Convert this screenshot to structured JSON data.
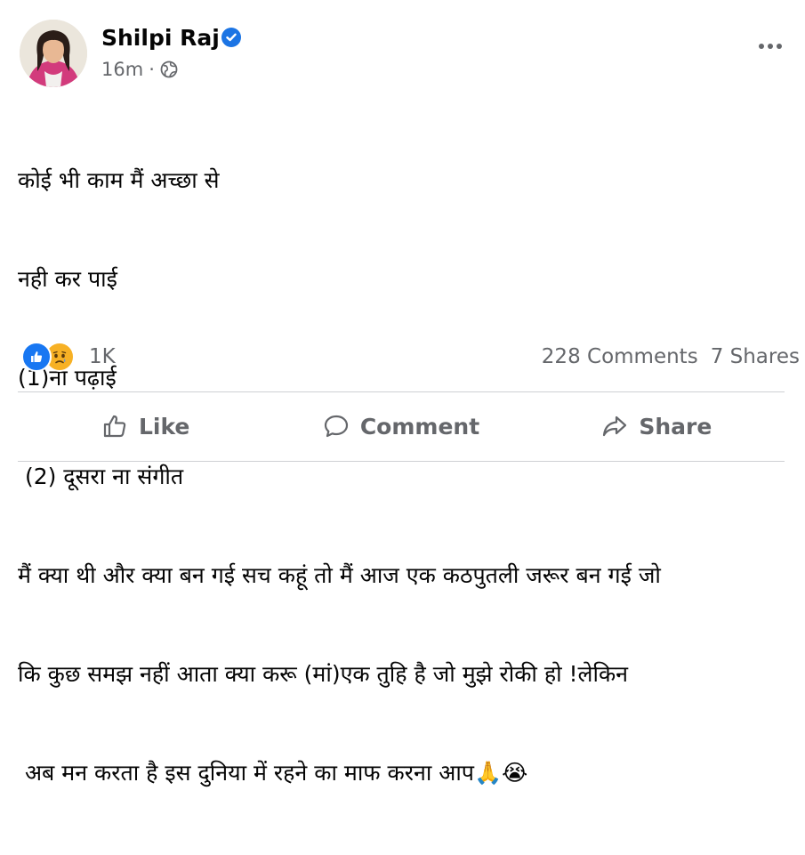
{
  "post": {
    "author": "Shilpi Raj",
    "time": "16m",
    "separator": "·",
    "text_lines": [
      "कोई भी काम मैं अच्छा से",
      "नही कर पाई",
      "(1)ना पढ़ाई",
      " (2) दूसरा ना संगीत",
      "मैं क्या थी और क्या बन गई सच कहूं तो मैं आज एक कठपुतली जरूर बन गई जो",
      "कि कुछ समझ नहीं आता क्या करू (मां)एक तुहि है जो मुझे रोकी हो !लेकिन",
      " अब मन करता है इस दुनिया में रहने का माफ करना आप🙏😭"
    ]
  },
  "stats": {
    "reactions": "1K",
    "comments": "228 Comments",
    "shares": "7 Shares"
  },
  "actions": {
    "like": "Like",
    "comment": "Comment",
    "share": "Share"
  },
  "colors": {
    "text": "#050505",
    "secondary": "#65676b",
    "brand_blue": "#1877f2",
    "sad_yellow": "#f7b125"
  },
  "icons": [
    "verified-badge-icon",
    "globe-icon",
    "more-options-icon",
    "like-reaction-icon",
    "sad-reaction-icon",
    "thumbs-up-icon",
    "comment-icon",
    "share-icon"
  ]
}
